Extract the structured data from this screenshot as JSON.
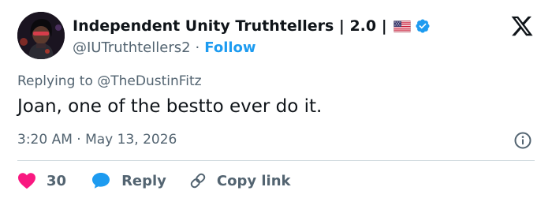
{
  "author": {
    "display_name": "Independent Unity Truthtellers | 2.0 |",
    "handle": "@IUTruthtellers2",
    "separator": "·",
    "follow_label": "Follow",
    "flag_icon": "us-flag-icon",
    "verified_icon": "verified-badge-icon",
    "verified_color": "#1d9bf0"
  },
  "platform": {
    "logo_icon": "x-logo-icon"
  },
  "tweet": {
    "replying_to": "Replying to @TheDustinFitz",
    "text": "Joan, one of the bestto ever do it.",
    "timestamp": "3:20 AM · May 13, 2026"
  },
  "actions": {
    "like_count": "30",
    "like_color": "#f91880",
    "reply_label": "Reply",
    "reply_color": "#1d9bf0",
    "copy_link_label": "Copy link"
  }
}
